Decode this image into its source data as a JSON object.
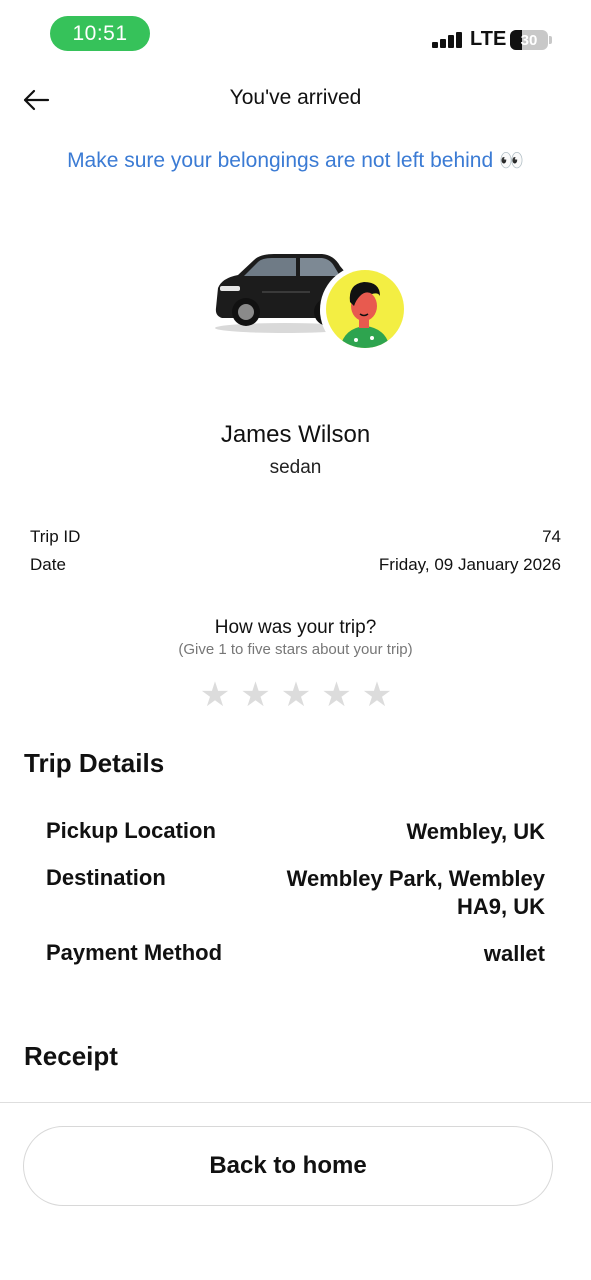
{
  "status_bar": {
    "time": "10:51",
    "network": "LTE",
    "battery": "30",
    "time_color": "#36c25a"
  },
  "header": {
    "title": "You've arrived",
    "back_icon": "arrow-left-icon"
  },
  "notice": {
    "text": "Make sure your belongings are not left behind",
    "emoji": "👀",
    "color": "#3b7bd4"
  },
  "driver": {
    "name": "James Wilson",
    "vehicle_type": "sedan"
  },
  "trip_info": {
    "trip_id_label": "Trip ID",
    "trip_id_value": "74",
    "date_label": "Date",
    "date_value": "Friday, 09 January 2026"
  },
  "rating": {
    "question": "How was your trip?",
    "hint": "(Give 1 to five stars about your trip)",
    "stars": [
      "★",
      "★",
      "★",
      "★",
      "★"
    ]
  },
  "trip_details": {
    "title": "Trip Details",
    "pickup_label": "Pickup Location",
    "pickup_value": "Wembley, UK",
    "destination_label": "Destination",
    "destination_value": "Wembley Park, Wembley HA9, UK",
    "payment_label": "Payment Method",
    "payment_value": "wallet"
  },
  "receipt": {
    "title": "Receipt"
  },
  "footer": {
    "home_button": "Back to home"
  }
}
